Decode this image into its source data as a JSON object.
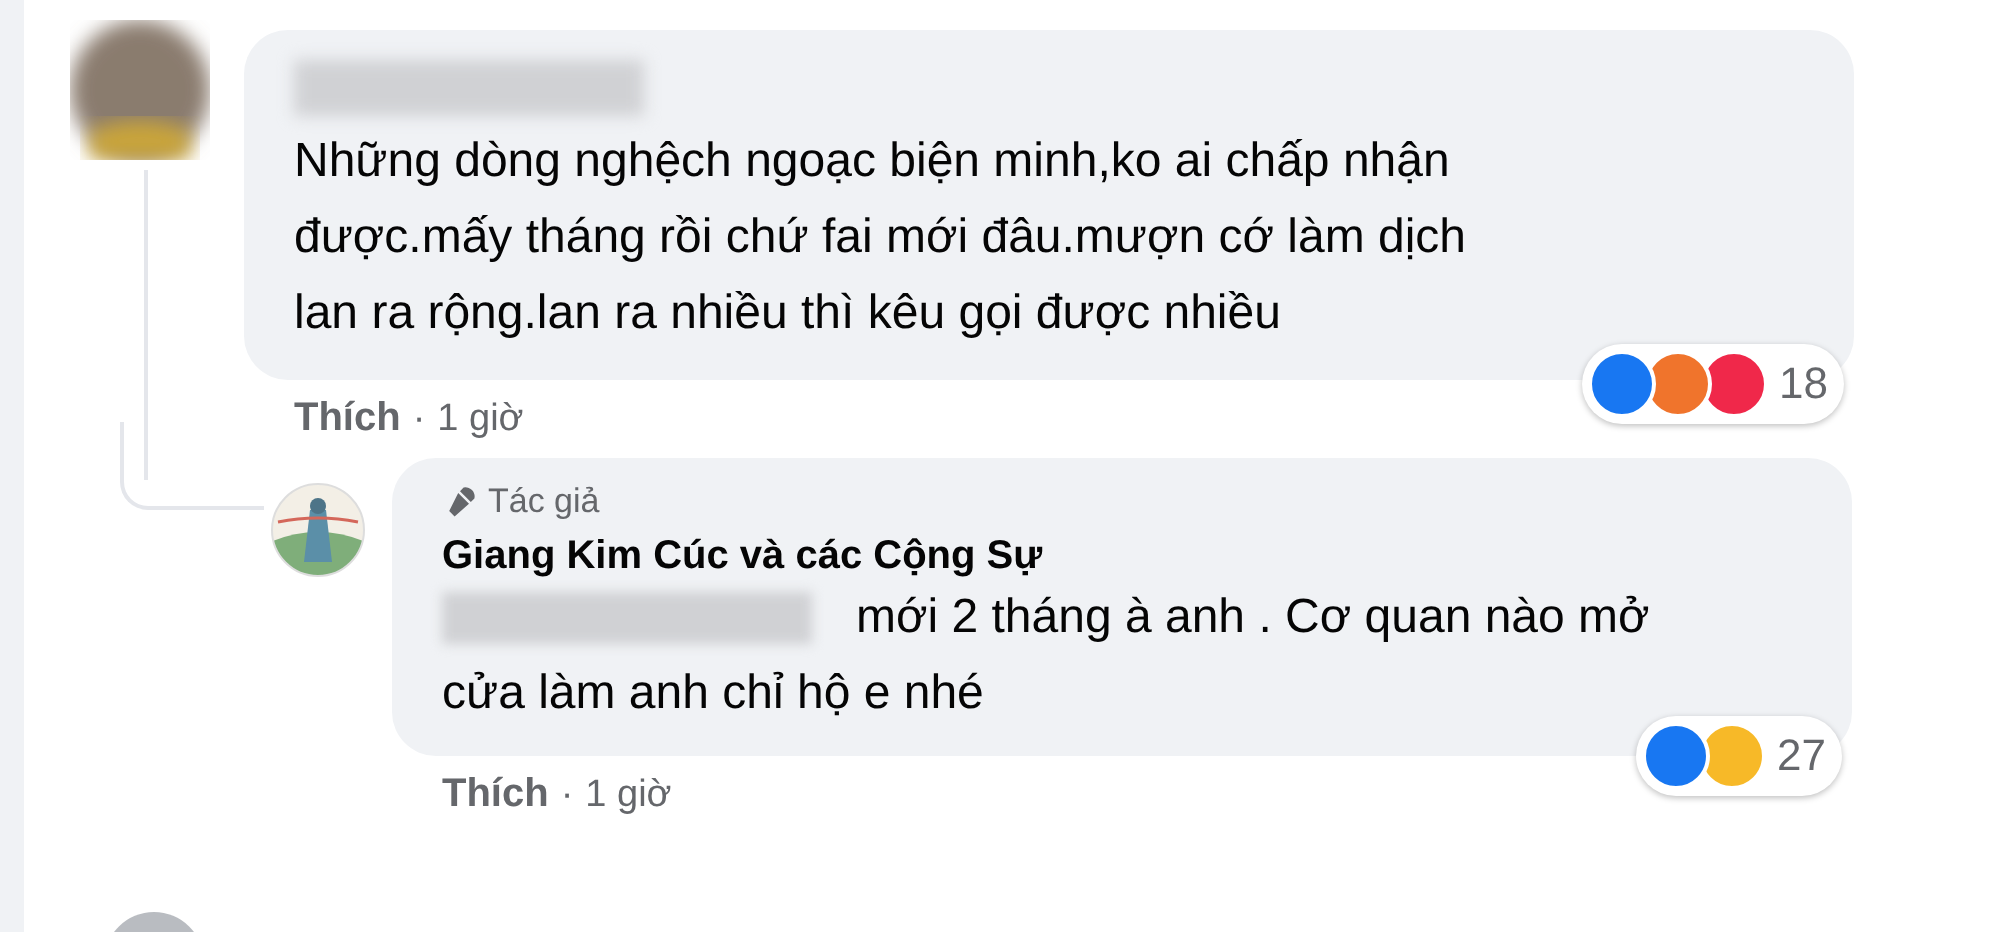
{
  "comments": [
    {
      "lines": [
        "Những dòng nghệch ngoạc biện minh,ko ai chấp nhận",
        "được.mấy tháng rồi chứ fai mới đâu.mượn cớ làm dịch",
        "lan ra rộng.lan ra nhiều thì kêu gọi được nhiều"
      ],
      "action": "Thích",
      "separator": "·",
      "time": "1 giờ",
      "reactions": [
        {
          "kind": "like"
        },
        {
          "kind": "angry"
        },
        {
          "kind": "love"
        }
      ],
      "reaction_count": "18",
      "replies": [
        {
          "badge": "Tác giả",
          "author": "Giang Kim Cúc và các Cộng Sự",
          "lines": [
            "mới 2 tháng à anh . Cơ quan nào mở",
            "cửa làm anh chỉ hộ e nhé"
          ],
          "action": "Thích",
          "separator": "·",
          "time": "1 giờ",
          "reactions": [
            {
              "kind": "like"
            },
            {
              "kind": "care"
            }
          ],
          "reaction_count": "27"
        }
      ]
    }
  ]
}
